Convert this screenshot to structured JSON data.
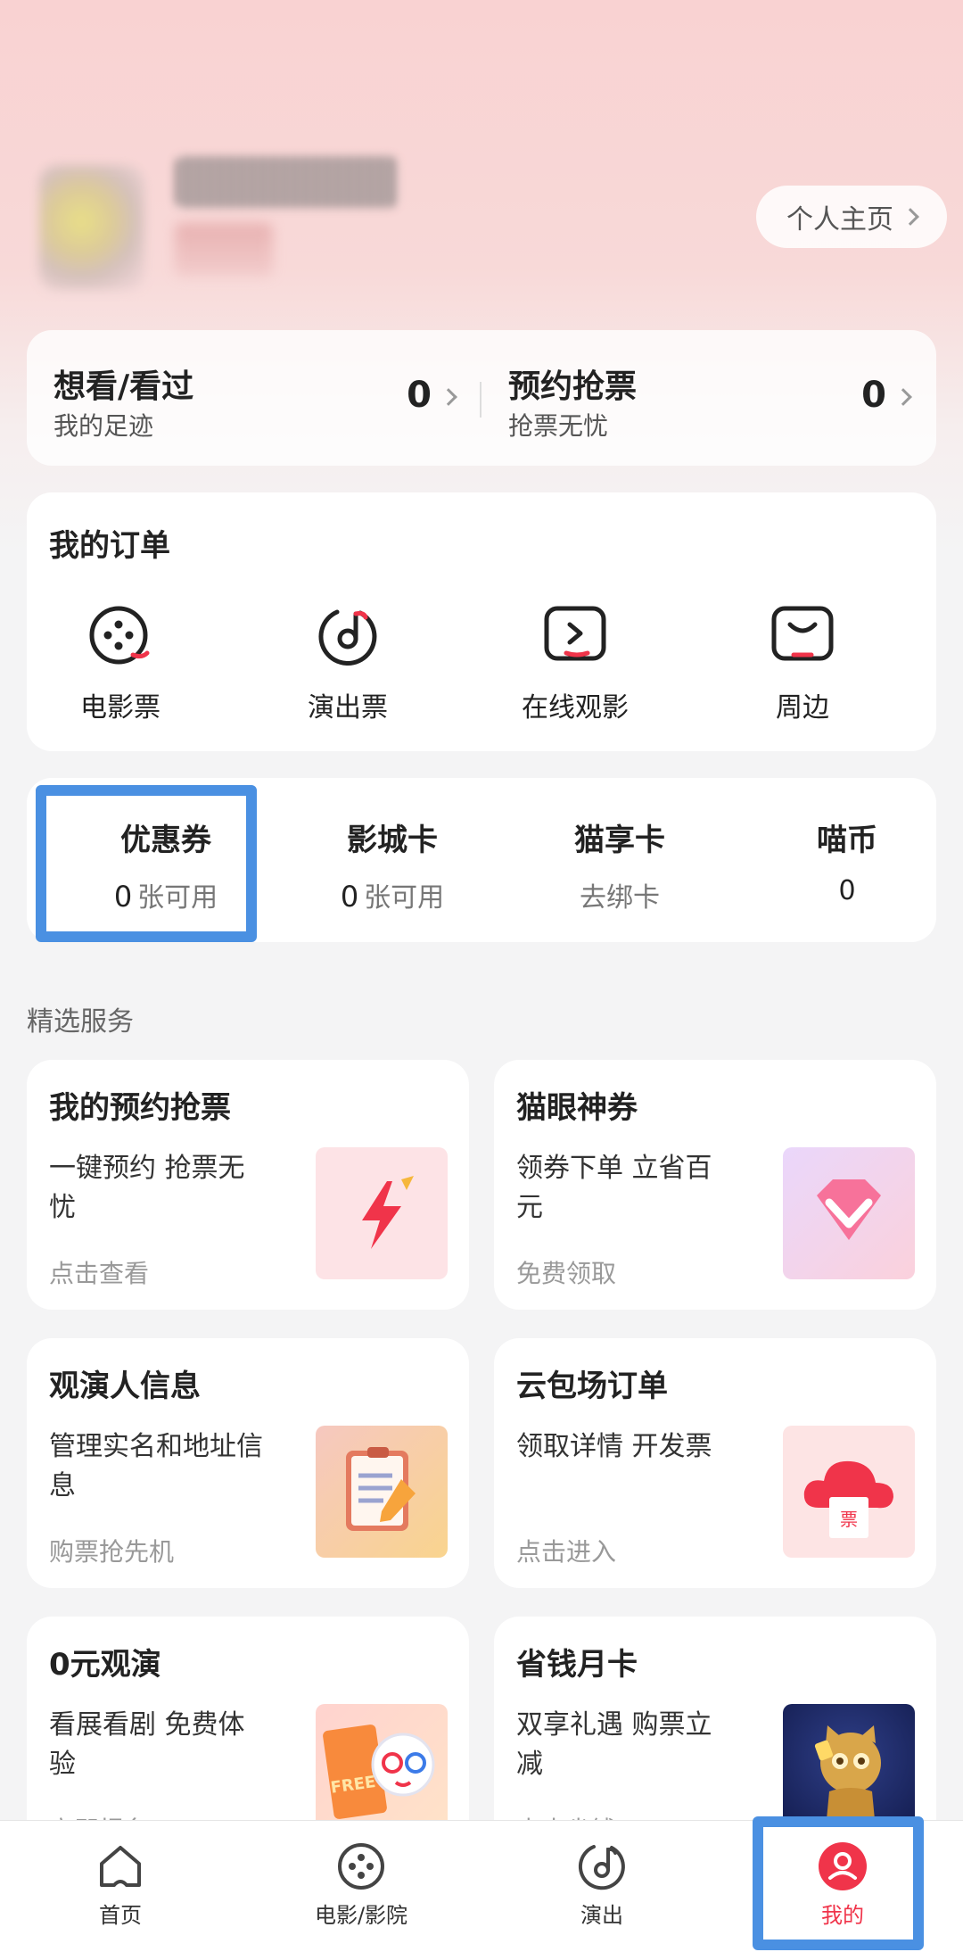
{
  "profile": {
    "homepage_label": "个人主页"
  },
  "tracker": {
    "left": {
      "title": "想看/看过",
      "subtitle": "我的足迹",
      "count": "0"
    },
    "right": {
      "title": "预约抢票",
      "subtitle": "抢票无忧",
      "count": "0"
    }
  },
  "orders": {
    "title": "我的订单",
    "items": [
      {
        "label": "电影票",
        "icon": "film-reel-icon"
      },
      {
        "label": "演出票",
        "icon": "music-disc-icon"
      },
      {
        "label": "在线观影",
        "icon": "play-screen-icon"
      },
      {
        "label": "周边",
        "icon": "smile-box-icon"
      }
    ]
  },
  "wallet": {
    "items": [
      {
        "title": "优惠券",
        "count": "0",
        "suffix": "张可用"
      },
      {
        "title": "影城卡",
        "count": "0",
        "suffix": "张可用"
      },
      {
        "title": "猫享卡",
        "suffix": "去绑卡"
      },
      {
        "title": "喵币",
        "count": "0"
      }
    ]
  },
  "services": {
    "section_title": "精选服务",
    "items": [
      {
        "title": "我的预约抢票",
        "desc": "一键预约 抢票无忧",
        "foot": "点击查看",
        "icon": "lightning-icon"
      },
      {
        "title": "猫眼神券",
        "desc": "领券下单 立省百元",
        "foot": "免费领取",
        "icon": "diamond-icon"
      },
      {
        "title": "观演人信息",
        "desc": "管理实名和地址信息",
        "foot": "购票抢先机",
        "icon": "clipboard-pencil-icon"
      },
      {
        "title": "云包场订单",
        "desc": "领取详情 开发票",
        "foot": "点击进入",
        "icon": "cloud-ticket-icon",
        "icon_text": "票"
      },
      {
        "title": "0元观演",
        "desc": "看展看剧 免费体验",
        "foot": "立即报名",
        "icon": "free-ticket-cat-icon",
        "icon_text": "FREE"
      },
      {
        "title": "省钱月卡",
        "desc": "双享礼遇 购票立减",
        "foot": "点击省钱",
        "icon": "gold-cat-icon"
      }
    ]
  },
  "tabbar": {
    "items": [
      {
        "label": "首页",
        "icon": "home-icon"
      },
      {
        "label": "电影/影院",
        "icon": "film-reel-icon"
      },
      {
        "label": "演出",
        "icon": "music-disc-icon"
      },
      {
        "label": "我的",
        "icon": "user-icon",
        "active": true
      }
    ]
  },
  "colors": {
    "accent": "#f0344a",
    "highlight": "#4a90e2"
  }
}
